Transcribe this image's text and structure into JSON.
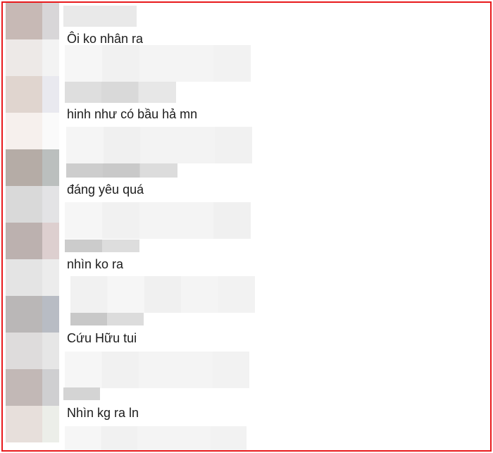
{
  "colors": {
    "border": "#e8191b",
    "text": "#1c1c1c"
  },
  "comments": [
    {
      "text": "Ôi ko nhân ra"
    },
    {
      "text": "hinh như có bầu hả mn"
    },
    {
      "text": "đáng yêu quá"
    },
    {
      "text": "nhìn ko ra"
    },
    {
      "text": "Cứu Hữu tui"
    },
    {
      "text": "Nhìn kg ra ln"
    }
  ]
}
